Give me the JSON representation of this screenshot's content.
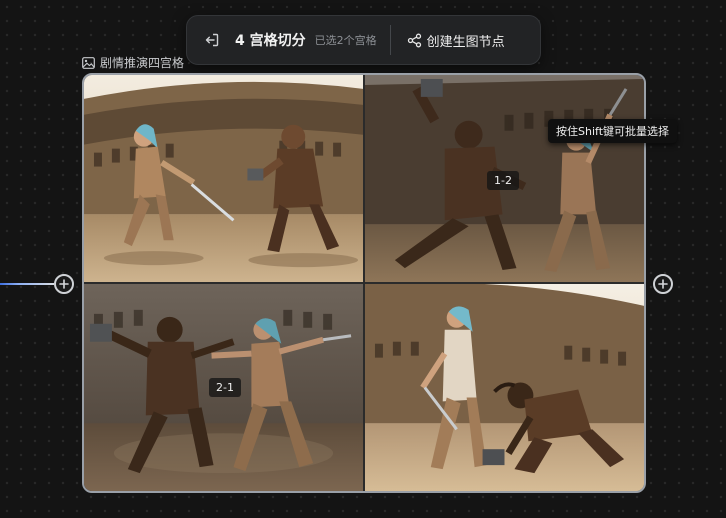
{
  "toolbar": {
    "title": "4 宫格切分",
    "status": "已选2个宫格",
    "create_label": "创建生图节点"
  },
  "node": {
    "label": "剧情推演四宫格"
  },
  "cells": [
    {
      "id": "1-1",
      "selected": false
    },
    {
      "id": "1-2",
      "tag": "1-2",
      "selected": true
    },
    {
      "id": "2-1",
      "tag": "2-1",
      "selected": true
    },
    {
      "id": "2-2",
      "selected": false
    }
  ],
  "tooltip": "按住Shift键可批量选择",
  "colors": {
    "selection": "#5b8fe0",
    "frame": "#9aa0a8",
    "wire": "#3d6fe0"
  }
}
